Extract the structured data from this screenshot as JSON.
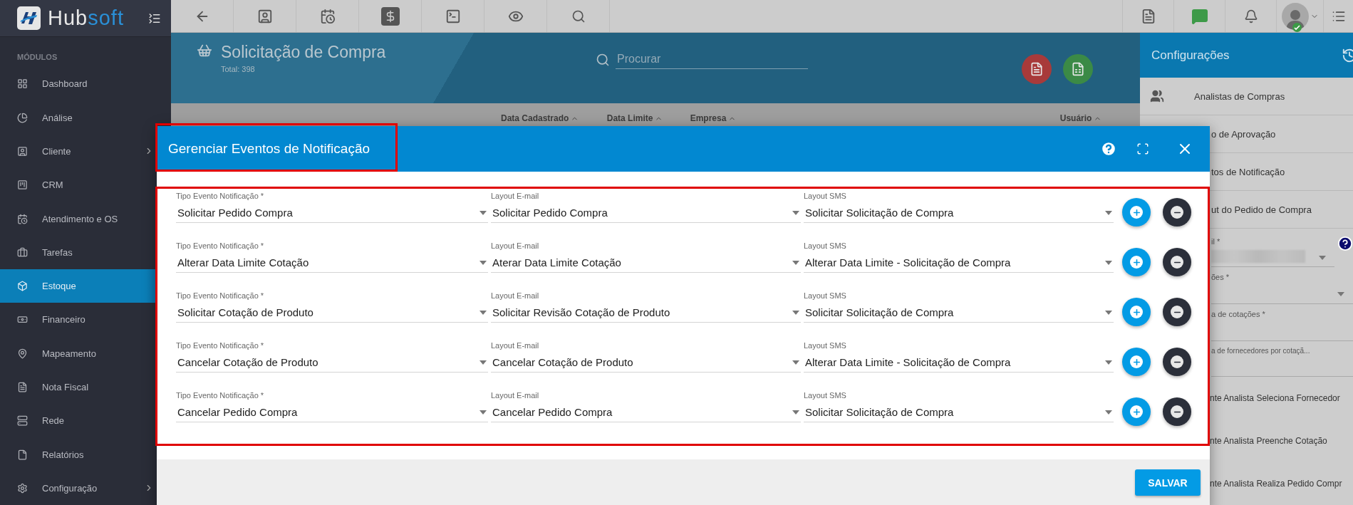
{
  "sidebar": {
    "brand_lead": "Hub",
    "brand_tail": "soft",
    "section_label": "MÓDULOS",
    "items": [
      {
        "label": "Dashboard",
        "selected": false,
        "expandable": false
      },
      {
        "label": "Análise",
        "selected": false,
        "expandable": false
      },
      {
        "label": "Cliente",
        "selected": false,
        "expandable": true
      },
      {
        "label": "CRM",
        "selected": false,
        "expandable": false
      },
      {
        "label": "Atendimento e OS",
        "selected": false,
        "expandable": false
      },
      {
        "label": "Tarefas",
        "selected": false,
        "expandable": false
      },
      {
        "label": "Estoque",
        "selected": true,
        "expandable": false
      },
      {
        "label": "Financeiro",
        "selected": false,
        "expandable": false
      },
      {
        "label": "Mapeamento",
        "selected": false,
        "expandable": false
      },
      {
        "label": "Nota Fiscal",
        "selected": false,
        "expandable": false
      },
      {
        "label": "Rede",
        "selected": false,
        "expandable": false
      },
      {
        "label": "Relatórios",
        "selected": false,
        "expandable": false
      },
      {
        "label": "Configuração",
        "selected": false,
        "expandable": true
      }
    ]
  },
  "page": {
    "title": "Solicitação de Compra",
    "total": "Total: 398",
    "search": {
      "placeholder": "Procurar"
    },
    "columns": [
      "Data Cadastrado",
      "Data Limite",
      "Empresa",
      "Usuário"
    ]
  },
  "config_panel": {
    "title": "Configurações",
    "items": [
      "Analistas de Compras",
      "o de Aprovação",
      "tos de Notificação",
      "ut do Pedido de Compra"
    ],
    "fields": [
      {
        "label": "il *",
        "kind": "blurred"
      },
      {
        "label": "ões *",
        "kind": "select"
      },
      {
        "label": "a de cotações *",
        "kind": "input"
      },
      {
        "label": "a de fornecedores por cotaçã...",
        "kind": "input"
      }
    ],
    "options": [
      "nte Analista Seleciona Fornecedor",
      "nte Analista Preenche Cotação",
      "nte Analista Realiza Pedido Compr"
    ]
  },
  "modal": {
    "title": "Gerenciar Eventos de Notificação",
    "save_button": "SALVAR",
    "rows": [
      {
        "fields": [
          {
            "label": "Tipo Evento Notificação *",
            "value": "Solicitar Pedido Compra"
          },
          {
            "label": "Layout E-mail",
            "value": "Solicitar Pedido Compra"
          },
          {
            "label": "Layout SMS",
            "value": "Solicitar Solicitação de Compra"
          }
        ]
      },
      {
        "fields": [
          {
            "label": "Tipo Evento Notificação *",
            "value": "Alterar Data Limite Cotação"
          },
          {
            "label": "Layout E-mail",
            "value": "Aterar Data Limite Cotação"
          },
          {
            "label": "Layout SMS",
            "value": "Alterar Data Limite - Solicitação de Compra"
          }
        ]
      },
      {
        "fields": [
          {
            "label": "Tipo Evento Notificação *",
            "value": "Solicitar Cotação de Produto"
          },
          {
            "label": "Layout E-mail",
            "value": "Solicitar Revisão Cotação de Produto"
          },
          {
            "label": "Layout SMS",
            "value": "Solicitar Solicitação de Compra"
          }
        ]
      },
      {
        "fields": [
          {
            "label": "Tipo Evento Notificação *",
            "value": "Cancelar Cotação de Produto"
          },
          {
            "label": "Layout E-mail",
            "value": "Cancelar Cotação de Produto"
          },
          {
            "label": "Layout SMS",
            "value": "Alterar Data Limite - Solicitação de Compra"
          }
        ]
      },
      {
        "fields": [
          {
            "label": "Tipo Evento Notificação *",
            "value": "Cancelar Pedido Compra"
          },
          {
            "label": "Layout E-mail",
            "value": "Cancelar Pedido Compra"
          },
          {
            "label": "Layout SMS",
            "value": "Solicitar Solicitação de Compra"
          }
        ]
      }
    ]
  }
}
